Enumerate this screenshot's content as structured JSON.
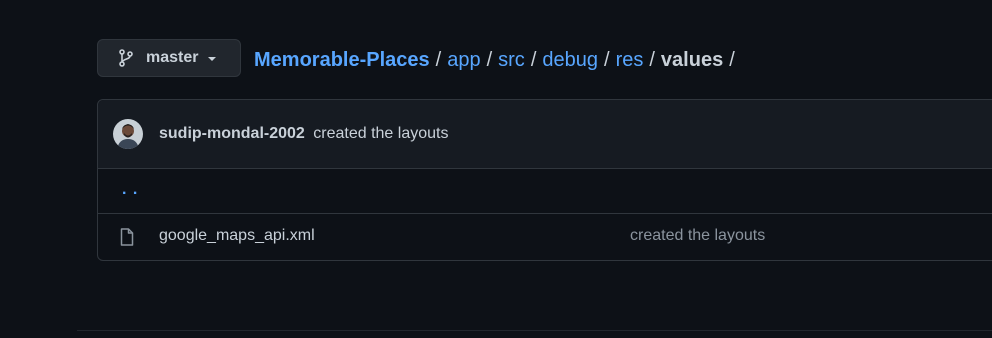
{
  "branch": {
    "name": "master"
  },
  "breadcrumb": {
    "root": "Memorable-Places",
    "parts": [
      "app",
      "src",
      "debug",
      "res"
    ],
    "current": "values",
    "separator": "/"
  },
  "latest_commit": {
    "author": "sudip-mondal-2002",
    "message": "created the layouts"
  },
  "parent_dir": {
    "label": ". ."
  },
  "files": [
    {
      "name": "google_maps_api.xml",
      "commit_message": "created the layouts",
      "icon": "file-icon"
    }
  ],
  "colors": {
    "background": "#0d1117",
    "link": "#58a6ff",
    "border": "#30363d",
    "muted": "#8b949e"
  }
}
